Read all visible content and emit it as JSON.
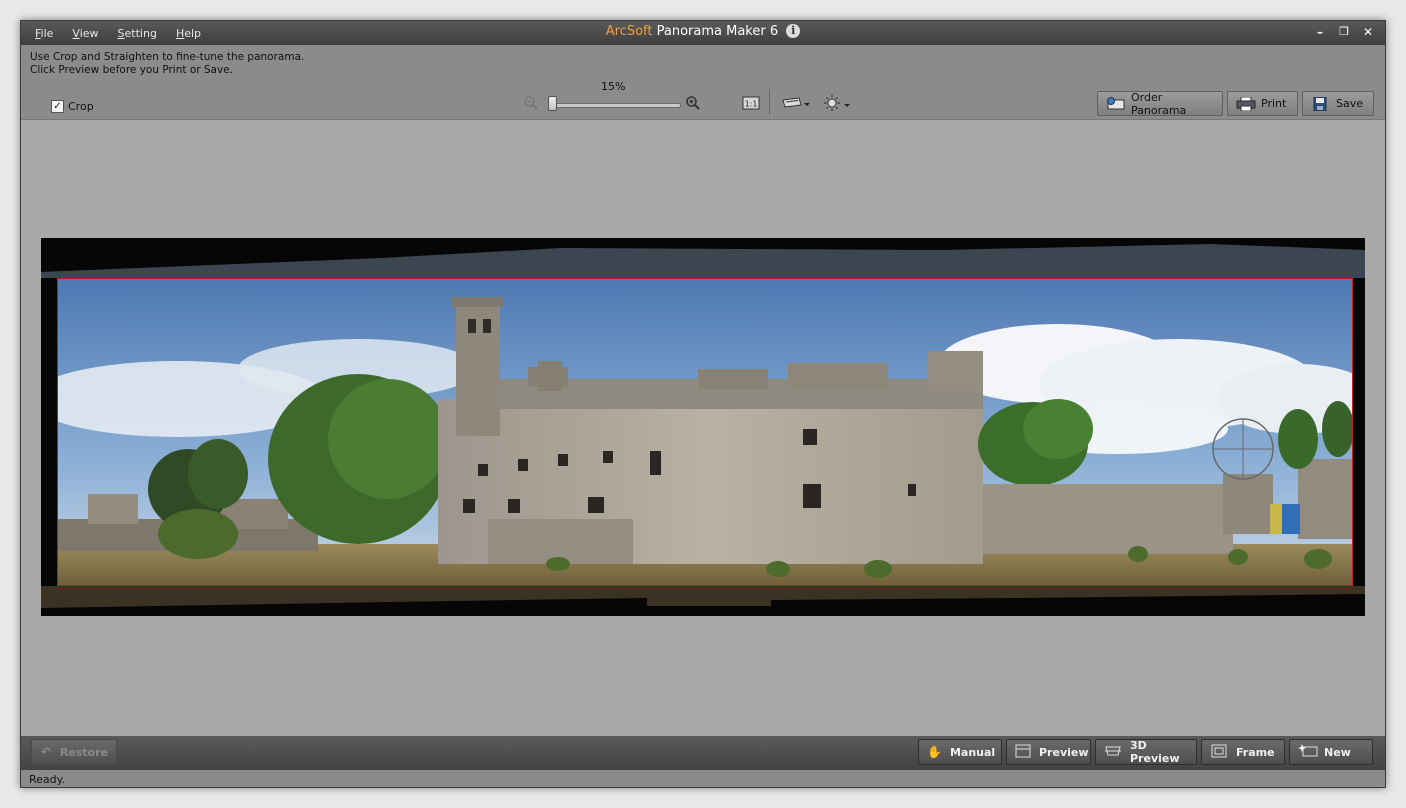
{
  "menu": {
    "file": "File",
    "view": "View",
    "setting": "Setting",
    "help": "Help"
  },
  "title": {
    "brand": "ArcSoft",
    "app": "Panorama Maker 6"
  },
  "window_controls": {
    "minimize": "–",
    "restore": "🗗",
    "close": "✕"
  },
  "instructions": {
    "line1": "Use Crop and Straighten to fine-tune the panorama.",
    "line2": "Click Preview before you Print or Save."
  },
  "crop": {
    "label": "Crop",
    "checked": true
  },
  "zoom": {
    "label": "15%",
    "level_percent": 15
  },
  "toolbar_buttons": {
    "order": "Order Panorama",
    "print": "Print",
    "save": "Save"
  },
  "bottom_buttons": {
    "restore": "Restore",
    "manual": "Manual",
    "preview": "Preview",
    "preview3d": "3D Preview",
    "frame": "Frame",
    "new": "New"
  },
  "status": {
    "text": "Ready."
  },
  "icons": {
    "info": "info-icon",
    "zoom_out": "zoom-out-icon",
    "zoom_in": "zoom-in-icon",
    "fit": "fit-screen-icon",
    "actual_size": "actual-size-icon",
    "straighten": "straighten-icon",
    "brightness": "brightness-icon"
  },
  "colors": {
    "brand": "#f0a040",
    "crop_border": "#b02020"
  }
}
